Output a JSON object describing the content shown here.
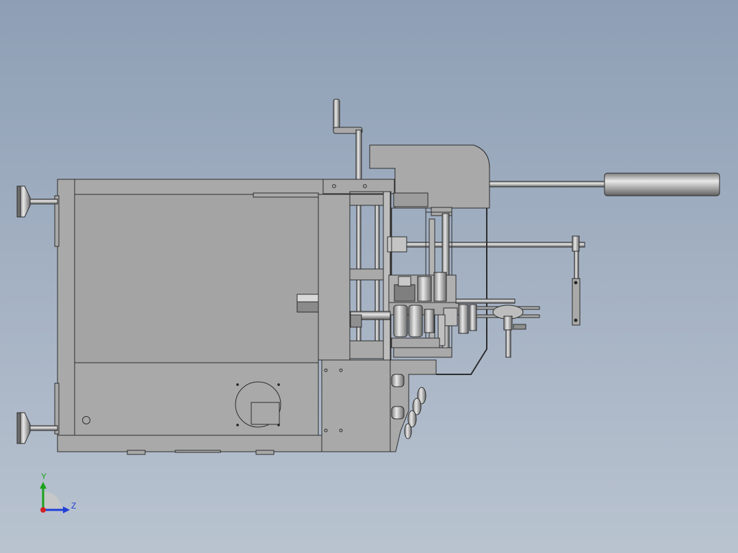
{
  "viewport": {
    "background_top": "#8e9fb5",
    "background_bottom": "#b9c3d0",
    "part_fill": "#a9a9a9",
    "part_stroke": "#2b2b2b"
  },
  "triad": {
    "y_label": "Y",
    "z_label": "Z",
    "y_color": "#19a319",
    "z_color": "#1f3fd6",
    "x_color": "#d12020"
  }
}
